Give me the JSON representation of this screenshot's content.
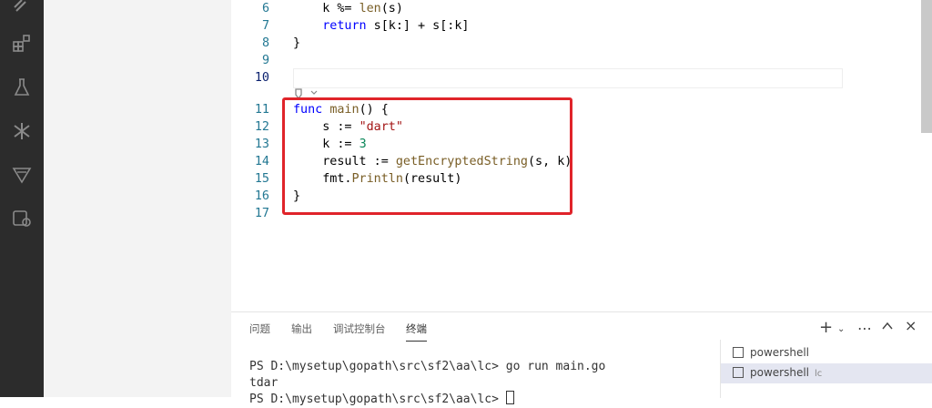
{
  "editor": {
    "lines": [
      {
        "num": "6",
        "tokens": [
          {
            "t": "    k %= "
          },
          {
            "t": "len",
            "c": "fn"
          },
          {
            "t": "(s)"
          }
        ]
      },
      {
        "num": "7",
        "tokens": [
          {
            "t": "    "
          },
          {
            "t": "return",
            "c": "kw"
          },
          {
            "t": " s[k:] + s[:k]"
          }
        ]
      },
      {
        "num": "8",
        "tokens": [
          {
            "t": "}"
          }
        ]
      },
      {
        "num": "9",
        "tokens": []
      },
      {
        "num": "10",
        "tokens": []
      },
      {
        "num": "11",
        "tokens": [
          {
            "t": "func",
            "c": "kw"
          },
          {
            "t": " "
          },
          {
            "t": "main",
            "c": "fn"
          },
          {
            "t": "() {"
          }
        ]
      },
      {
        "num": "12",
        "tokens": [
          {
            "t": "    s := "
          },
          {
            "t": "\"dart\"",
            "c": "str"
          }
        ]
      },
      {
        "num": "13",
        "tokens": [
          {
            "t": "    k := "
          },
          {
            "t": "3",
            "c": "num"
          }
        ]
      },
      {
        "num": "14",
        "tokens": [
          {
            "t": "    result := "
          },
          {
            "t": "getEncryptedString",
            "c": "fn"
          },
          {
            "t": "(s, k)"
          }
        ]
      },
      {
        "num": "15",
        "tokens": [
          {
            "t": "    fmt."
          },
          {
            "t": "Println",
            "c": "fn"
          },
          {
            "t": "(result)"
          }
        ]
      },
      {
        "num": "16",
        "tokens": [
          {
            "t": "}"
          }
        ]
      },
      {
        "num": "17",
        "tokens": []
      }
    ]
  },
  "panel": {
    "tabs": [
      "问题",
      "输出",
      "调试控制台",
      "终端"
    ],
    "active_tab": "终端",
    "terminal_lines": [
      "PS D:\\mysetup\\gopath\\src\\sf2\\aa\\lc> go run main.go",
      "tdar",
      "PS D:\\mysetup\\gopath\\src\\sf2\\aa\\lc> "
    ],
    "terminals": [
      {
        "label": "powershell",
        "sub": ""
      },
      {
        "label": "powershell",
        "sub": "lc"
      }
    ]
  },
  "colors": {
    "highlight": "#e0242a",
    "activitybar": "#2c2c2c"
  }
}
